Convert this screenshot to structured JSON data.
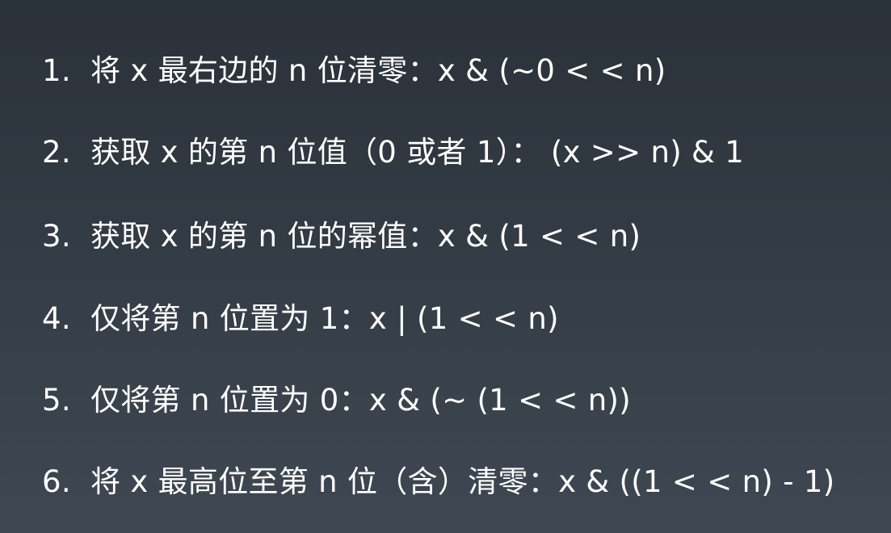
{
  "items": [
    {
      "number": "1.",
      "text": "将 x 最右边的 n 位清零：x & (~0 < < n)"
    },
    {
      "number": "2.",
      "text": "获取 x 的第 n 位值（0 或者 1）： (x >> n) & 1"
    },
    {
      "number": "3.",
      "text": "获取 x 的第 n 位的幂值：x & (1 < < n)"
    },
    {
      "number": "4.",
      "text": "仅将第 n 位置为 1：x | (1 < < n)"
    },
    {
      "number": "5.",
      "text": "仅将第 n 位置为 0：x & (~ (1 < < n))"
    },
    {
      "number": "6.",
      "text": "将 x 最高位至第 n 位（含）清零：x & ((1 < < n) - 1)"
    }
  ]
}
